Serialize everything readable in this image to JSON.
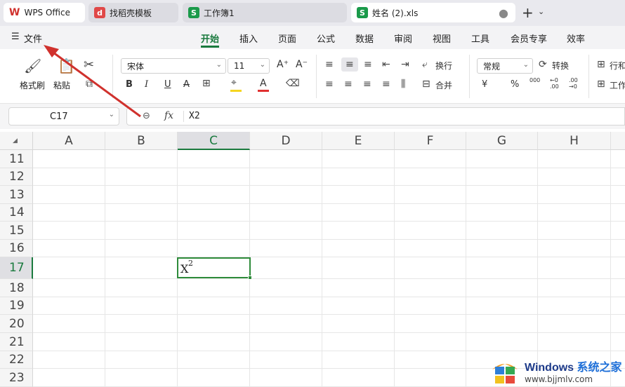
{
  "tabs": [
    {
      "label": "WPS Office",
      "icon": "wps-logo-icon"
    },
    {
      "label": "找稻壳模板",
      "icon": "docer-icon"
    },
    {
      "label": "工作簿1",
      "icon": "sheet-s-icon"
    },
    {
      "label": "姓名 (2).xls",
      "icon": "sheet-s-icon"
    }
  ],
  "tab_dirty": "●",
  "new_tab": "+",
  "tab_more": "⌄",
  "menu": {
    "file": "文件",
    "items": [
      "开始",
      "插入",
      "页面",
      "公式",
      "数据",
      "审阅",
      "视图",
      "工具",
      "会员专享",
      "效率"
    ],
    "active": "开始"
  },
  "ribbon": {
    "format_painter": "格式刷",
    "paste": "粘贴",
    "font_name": "宋体",
    "font_size": "11",
    "wrap": "换行",
    "merge": "合并",
    "number_format": "常规",
    "convert": "转换",
    "row_col": "行和",
    "sheet": "工作",
    "bold": "B",
    "italic": "I",
    "underline": "U",
    "strike": "A",
    "percent": "%",
    "thousands": "000",
    "currency": "¥",
    "inc_font": "A⁺",
    "dec_font": "A⁻",
    "font_color_a": "A",
    "inc_decimal": "←0\n.00",
    "dec_decimal": ".00\n→0"
  },
  "formula_bar": {
    "name_box": "C17",
    "fx": "fx",
    "content": "X2"
  },
  "columns": [
    "A",
    "B",
    "C",
    "D",
    "E",
    "F",
    "G",
    "H"
  ],
  "selected_column": "C",
  "rows": [
    "11",
    "12",
    "13",
    "14",
    "15",
    "16",
    "17",
    "18",
    "19",
    "20",
    "21",
    "22",
    "23"
  ],
  "selected_row": "17",
  "cell_c17": {
    "base": "X",
    "sup": "2"
  },
  "watermark": {
    "title": "Windows",
    "title_cn": "系统之家",
    "url": "www.bjjmlv.com"
  },
  "colors": {
    "accent": "#1a7a3e",
    "arrow": "#d0312d",
    "tab_bg": "#e9e9ee",
    "menu_bg": "#f3f3f5",
    "font_color_bar": "#e03030",
    "highlight_bar": "#f5d520"
  }
}
